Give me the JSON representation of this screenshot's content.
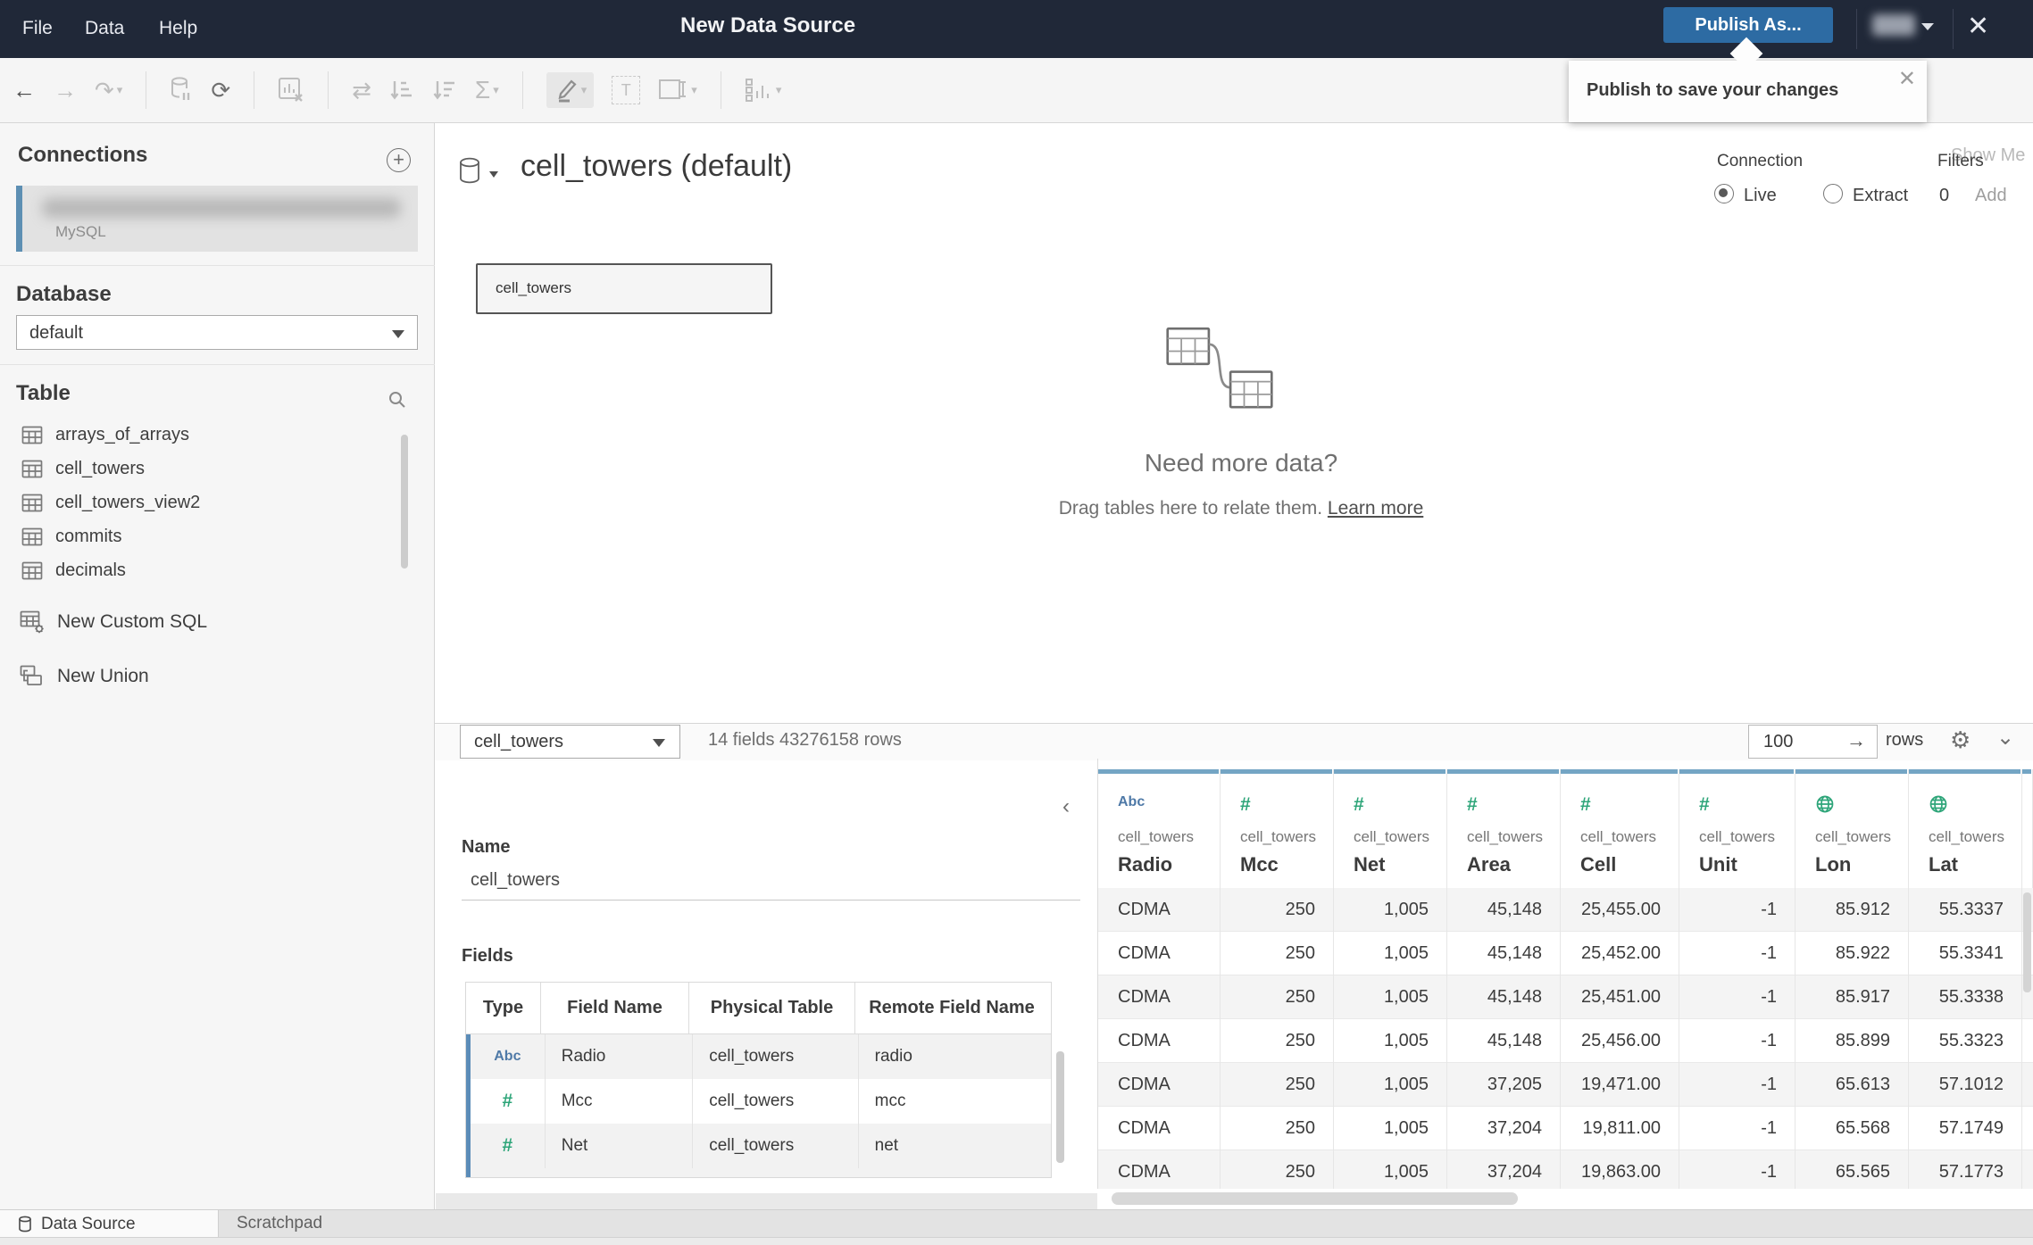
{
  "colors": {
    "accent_blue": "#2d6ba3",
    "column_blue": "#74a5c4",
    "type_green": "#2ea579",
    "type_abc_blue": "#4e79a7",
    "selection_bar": "#5d8fb3"
  },
  "titlebar": {
    "menus": [
      "File",
      "Data",
      "Help"
    ],
    "title": "New Data Source",
    "publish_label": "Publish As...",
    "close_glyph": "✕"
  },
  "tooltip": {
    "text": "Publish to save your changes",
    "close_glyph": "✕"
  },
  "toolbar": {
    "show_me": "Show Me",
    "sigma": "Σ",
    "text_tool": "T"
  },
  "sidebar": {
    "connections_title": "Connections",
    "connection": {
      "subtitle": "MySQL"
    },
    "database_title": "Database",
    "database_value": "default",
    "table_title": "Table",
    "tables": [
      "arrays_of_arrays",
      "cell_towers",
      "cell_towers_view2",
      "commits",
      "decimals"
    ],
    "actions": [
      {
        "label": "New Custom SQL"
      },
      {
        "label": "New Union"
      }
    ]
  },
  "canvas": {
    "datasource_title": "cell_towers (default)",
    "connection_label": "Connection",
    "live_label": "Live",
    "extract_label": "Extract",
    "filters_label": "Filters",
    "filters_count": "0",
    "filters_add": "Add",
    "table_node_label": "cell_towers",
    "empty_title": "Need more data?",
    "empty_subtitle": "Drag tables here to relate them.",
    "learn_more": "Learn more"
  },
  "preview": {
    "table_select_value": "cell_towers",
    "meta": "14 fields 43276158 rows",
    "row_count": "100",
    "rows_label": "rows",
    "panel": {
      "name_label": "Name",
      "name_value": "cell_towers",
      "fields_label": "Fields",
      "columns": [
        "Type",
        "Field Name",
        "Physical Table",
        "Remote Field Name"
      ],
      "rows": [
        {
          "type": "Abc",
          "field": "Radio",
          "table": "cell_towers",
          "remote": "radio"
        },
        {
          "type": "#",
          "field": "Mcc",
          "table": "cell_towers",
          "remote": "mcc"
        },
        {
          "type": "#",
          "field": "Net",
          "table": "cell_towers",
          "remote": "net"
        }
      ]
    },
    "grid": {
      "source": "cell_towers",
      "columns": [
        {
          "name": "Radio",
          "type": "Abc"
        },
        {
          "name": "Mcc",
          "type": "#"
        },
        {
          "name": "Net",
          "type": "#"
        },
        {
          "name": "Area",
          "type": "#"
        },
        {
          "name": "Cell",
          "type": "#"
        },
        {
          "name": "Unit",
          "type": "#"
        },
        {
          "name": "Lon",
          "type": "globe"
        },
        {
          "name": "Lat",
          "type": "globe"
        }
      ],
      "rows": [
        [
          "CDMA",
          "250",
          "1,005",
          "45,148",
          "25,455.00",
          "-1",
          "85.912",
          "55.3337"
        ],
        [
          "CDMA",
          "250",
          "1,005",
          "45,148",
          "25,452.00",
          "-1",
          "85.922",
          "55.3341"
        ],
        [
          "CDMA",
          "250",
          "1,005",
          "45,148",
          "25,451.00",
          "-1",
          "85.917",
          "55.3338"
        ],
        [
          "CDMA",
          "250",
          "1,005",
          "45,148",
          "25,456.00",
          "-1",
          "85.899",
          "55.3323"
        ],
        [
          "CDMA",
          "250",
          "1,005",
          "37,205",
          "19,471.00",
          "-1",
          "65.613",
          "57.1012"
        ],
        [
          "CDMA",
          "250",
          "1,005",
          "37,204",
          "19,811.00",
          "-1",
          "65.568",
          "57.1749"
        ],
        [
          "CDMA",
          "250",
          "1,005",
          "37,204",
          "19,863.00",
          "-1",
          "65.565",
          "57.1773"
        ]
      ]
    }
  },
  "bottom_tabs": {
    "data_source": "Data Source",
    "scratchpad": "Scratchpad"
  }
}
